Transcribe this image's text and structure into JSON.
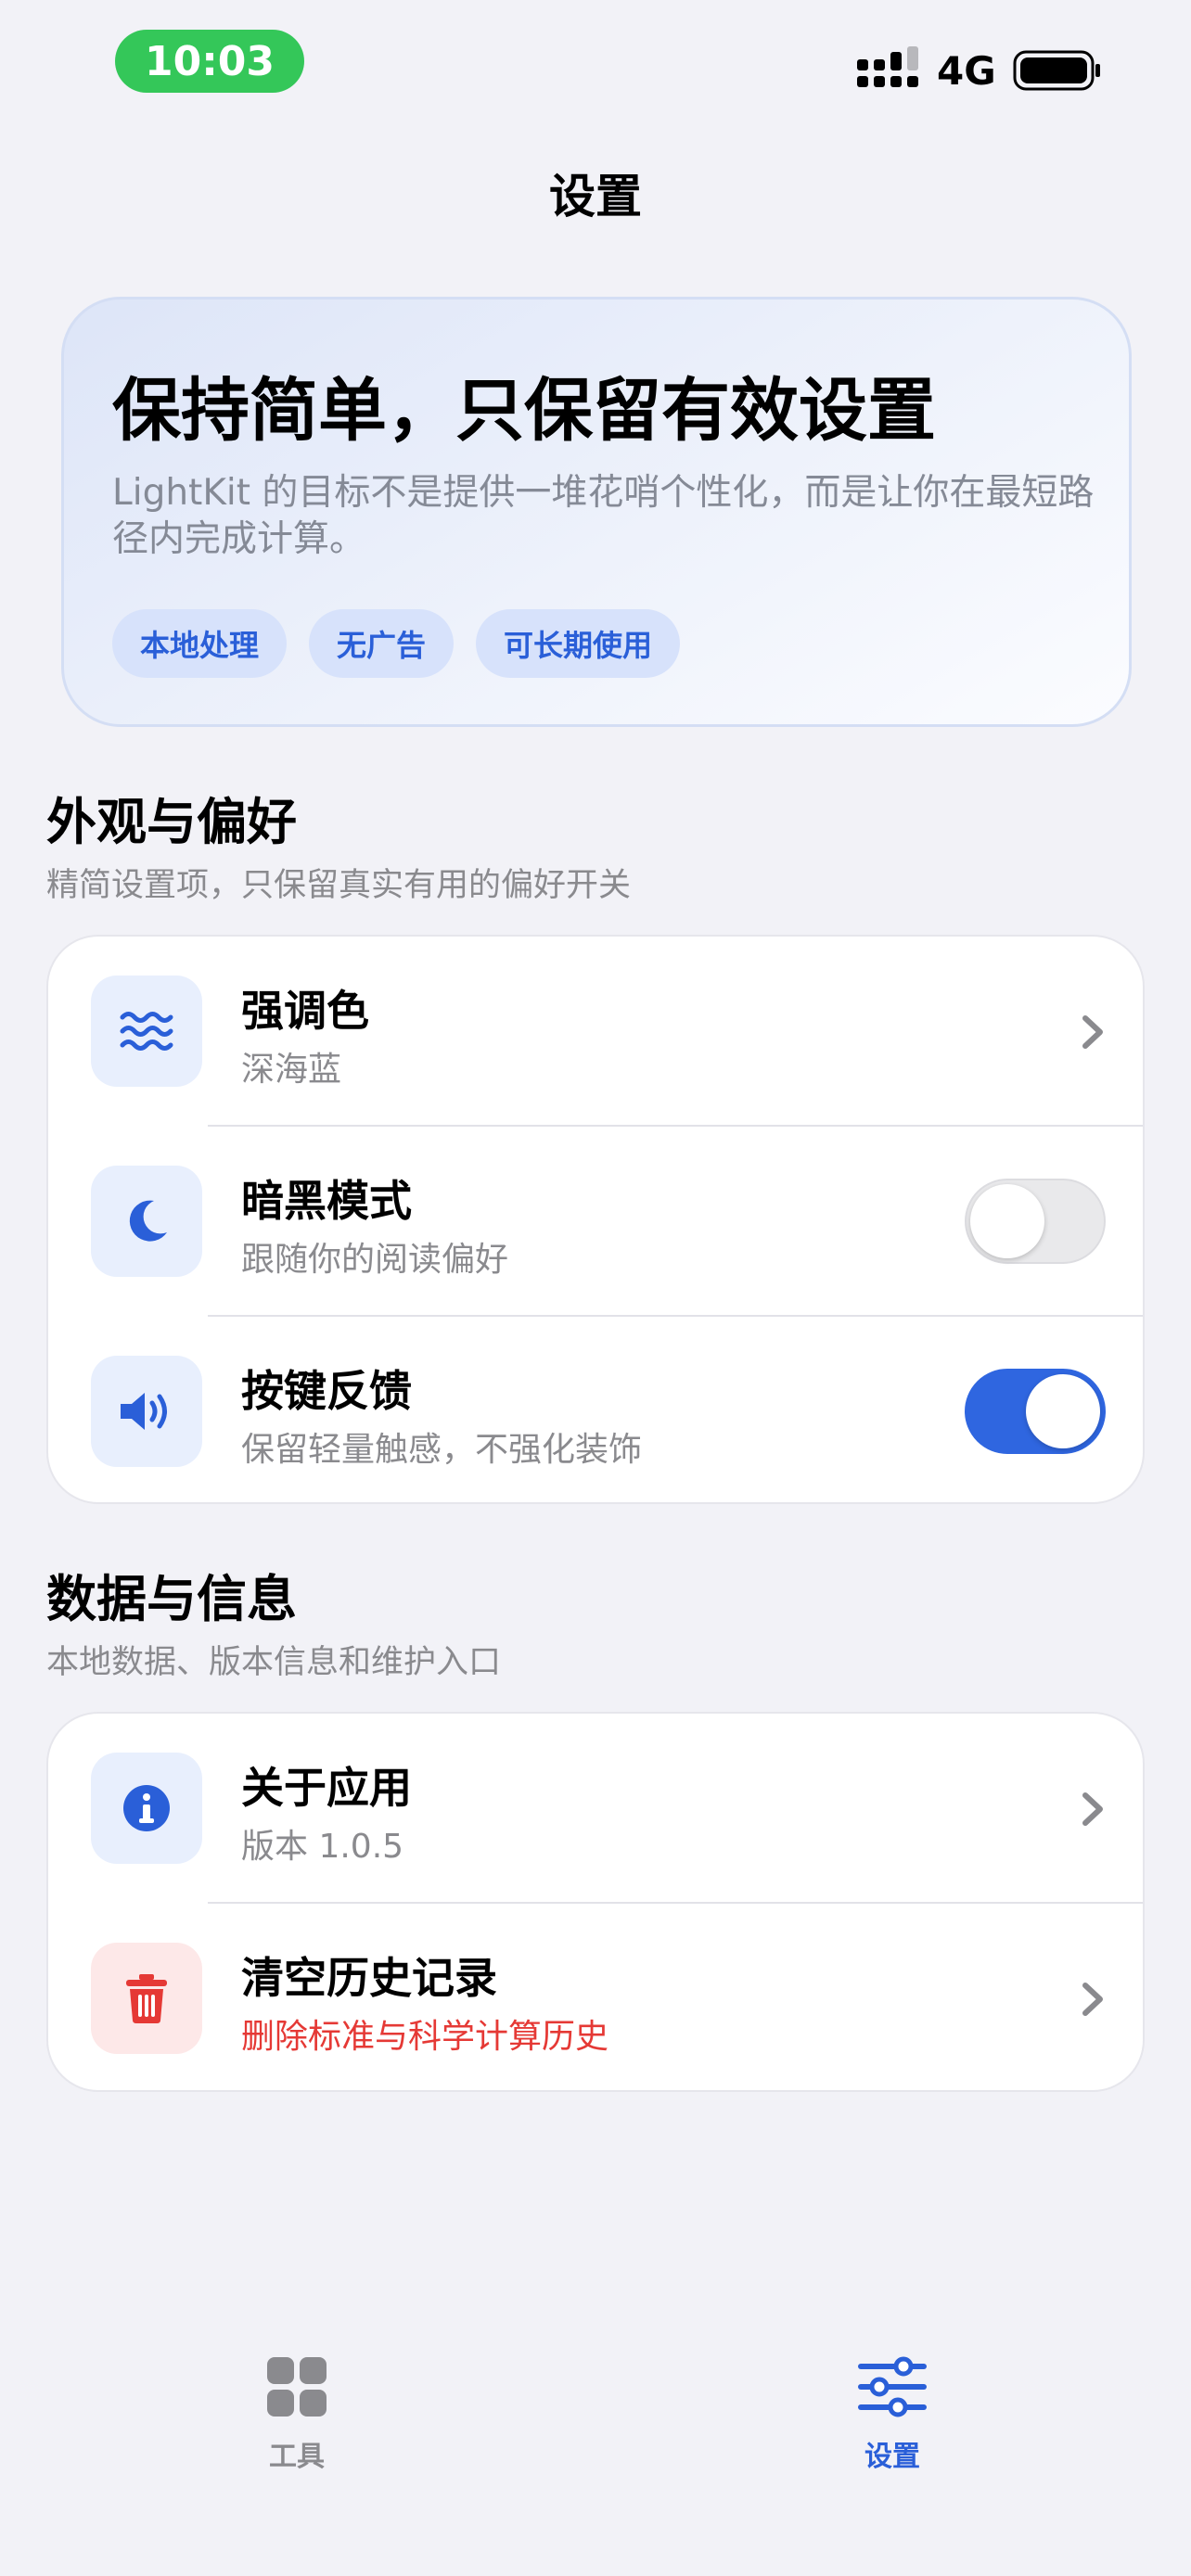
{
  "status_bar": {
    "time": "10:03",
    "network": "4G"
  },
  "nav": {
    "title": "设置"
  },
  "hero": {
    "title": "保持简单，只保留有效设置",
    "description": "LightKit 的目标不是提供一堆花哨个性化，而是让你在最短路径内完成计算。",
    "chips": [
      "本地处理",
      "无广告",
      "可长期使用"
    ]
  },
  "appearance": {
    "title": "外观与偏好",
    "subtitle": "精简设置项，只保留真实有用的偏好开关",
    "items": [
      {
        "icon": "waves-icon",
        "title": "强调色",
        "subtitle": "深海蓝",
        "control": "chevron"
      },
      {
        "icon": "moon-icon",
        "title": "暗黑模式",
        "subtitle": "跟随你的阅读偏好",
        "control": "toggle",
        "on": false
      },
      {
        "icon": "speaker-icon",
        "title": "按键反馈",
        "subtitle": "保留轻量触感，不强化装饰",
        "control": "toggle",
        "on": true
      }
    ]
  },
  "data_info": {
    "title": "数据与信息",
    "subtitle": "本地数据、版本信息和维护入口",
    "items": [
      {
        "icon": "info-icon",
        "title": "关于应用",
        "subtitle": "版本 1.0.5",
        "control": "chevron"
      },
      {
        "icon": "trash-icon",
        "title": "清空历史记录",
        "subtitle": "删除标准与科学计算历史",
        "control": "chevron",
        "danger": true
      }
    ]
  },
  "tabbar": {
    "tabs": [
      {
        "icon": "grid-icon",
        "label": "工具",
        "active": false
      },
      {
        "icon": "sliders-icon",
        "label": "设置",
        "active": true
      }
    ]
  },
  "colors": {
    "accent": "#2f66e0",
    "danger": "#e53935",
    "status_green": "#34c759"
  }
}
